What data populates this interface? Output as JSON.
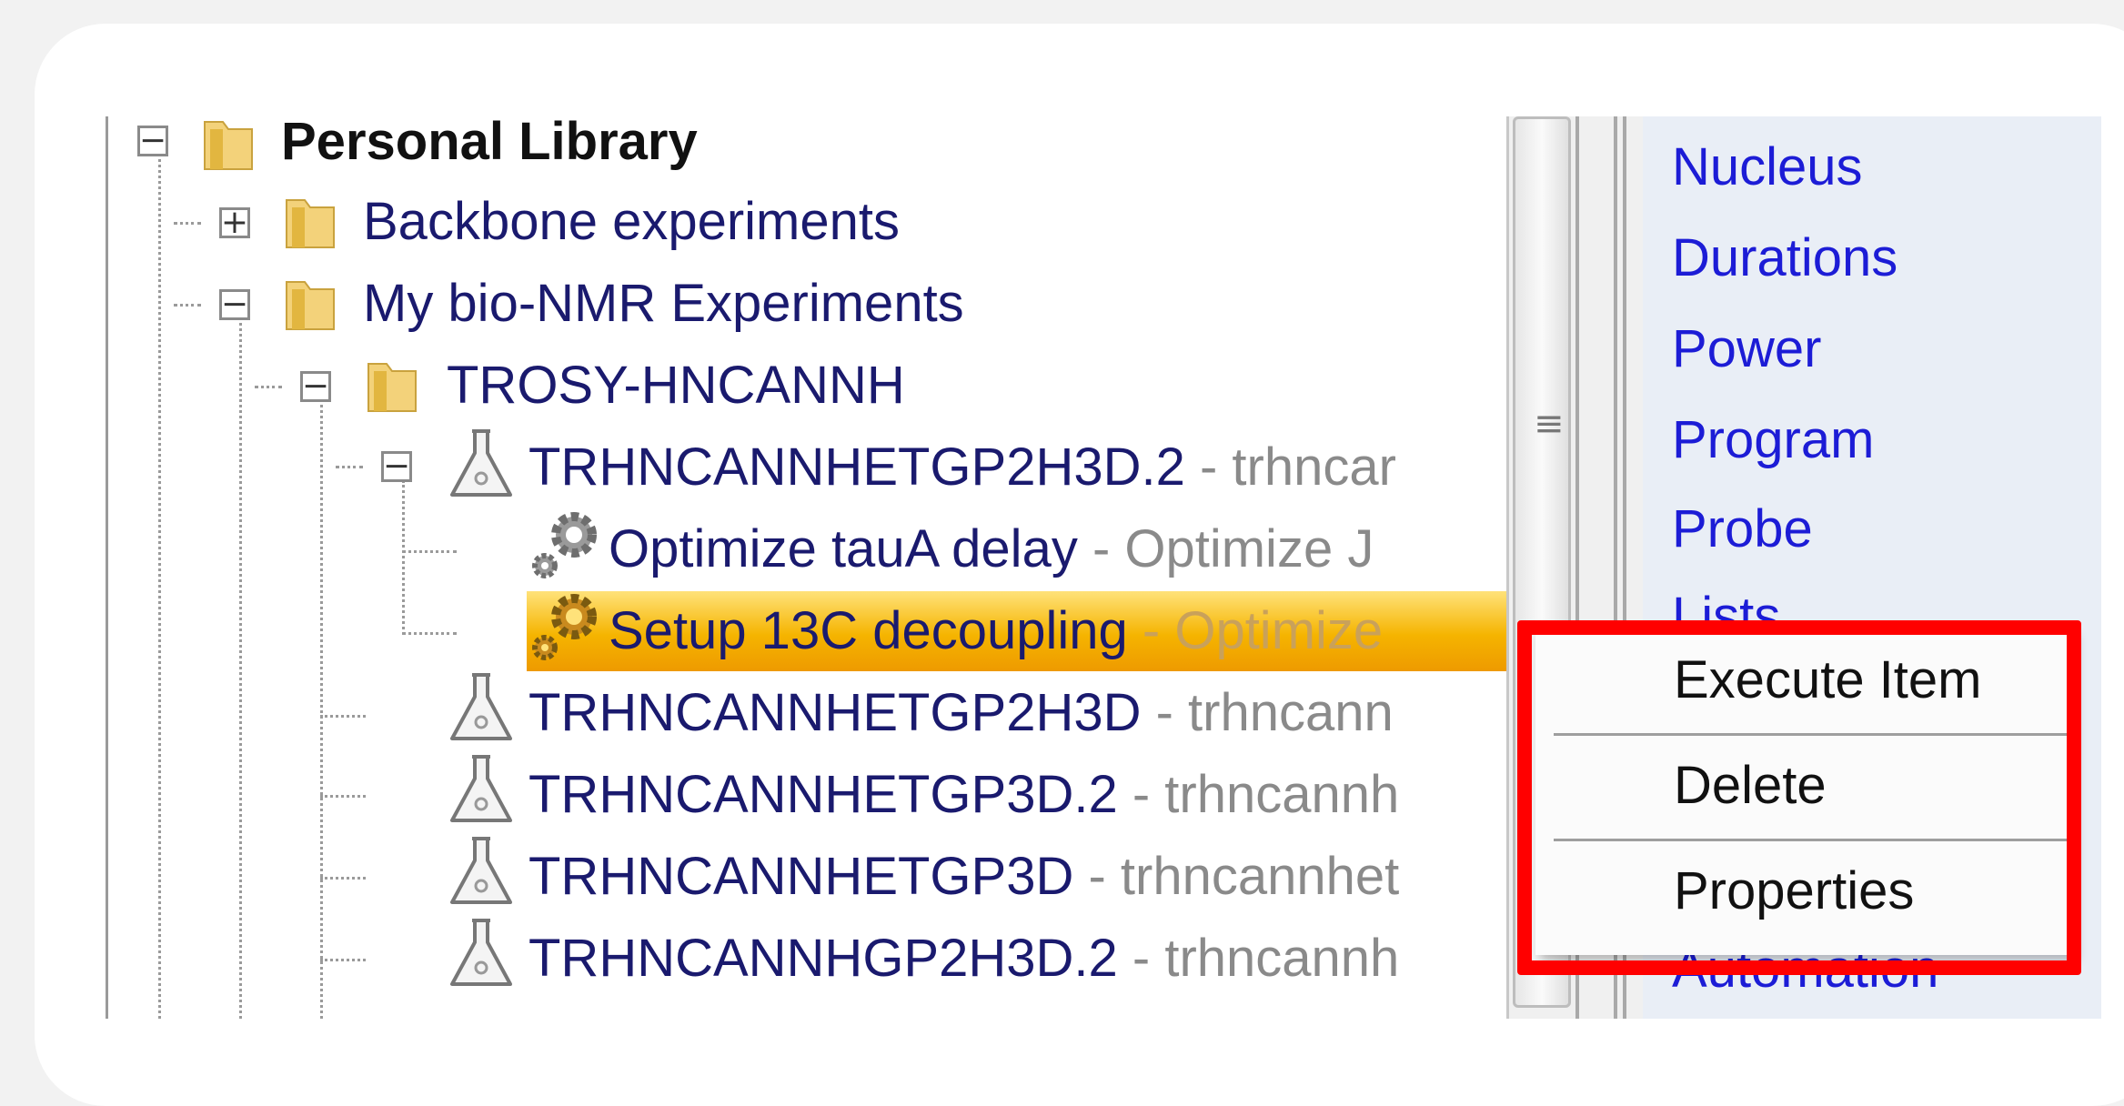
{
  "tree": {
    "rows": [
      {
        "label": "Personal Library",
        "desc": ""
      },
      {
        "label": "Backbone experiments",
        "desc": ""
      },
      {
        "label": "My bio-NMR Experiments",
        "desc": ""
      },
      {
        "label": "TROSY-HNCANNH",
        "desc": ""
      },
      {
        "label": "TRHNCANNHETGP2H3D.2",
        "desc": " - trhncar"
      },
      {
        "label": "Optimize tauA delay",
        "desc": " - Optimize J"
      },
      {
        "label": "Setup 13C decoupling",
        "desc": " - Optimize"
      },
      {
        "label": "TRHNCANNHETGP2H3D",
        "desc": " - trhncann"
      },
      {
        "label": "TRHNCANNHETGP3D.2",
        "desc": " - trhncannh"
      },
      {
        "label": "TRHNCANNHETGP3D",
        "desc": " - trhncannhet"
      },
      {
        "label": "TRHNCANNHGP2H3D.2",
        "desc": " - trhncannh"
      }
    ],
    "selected_index": 6
  },
  "icons": {
    "folder": "folder-icon",
    "flask": "flask-icon",
    "gear": "gear-icon",
    "collapse": "minus-box-icon",
    "expand": "plus-box-icon"
  },
  "right_panel": {
    "links": [
      "Nucleus",
      "Durations",
      "Power",
      "Program",
      "Probe",
      "Lists",
      "Automation"
    ]
  },
  "context_menu": {
    "items": [
      "Execute Item",
      "Delete",
      "Properties"
    ]
  },
  "colors": {
    "link": "#1c1cd6",
    "selection": "#f5b400",
    "highlight": "#ff0000",
    "tree_text": "#1a1a6e",
    "desc_text": "#8a8a8a"
  }
}
